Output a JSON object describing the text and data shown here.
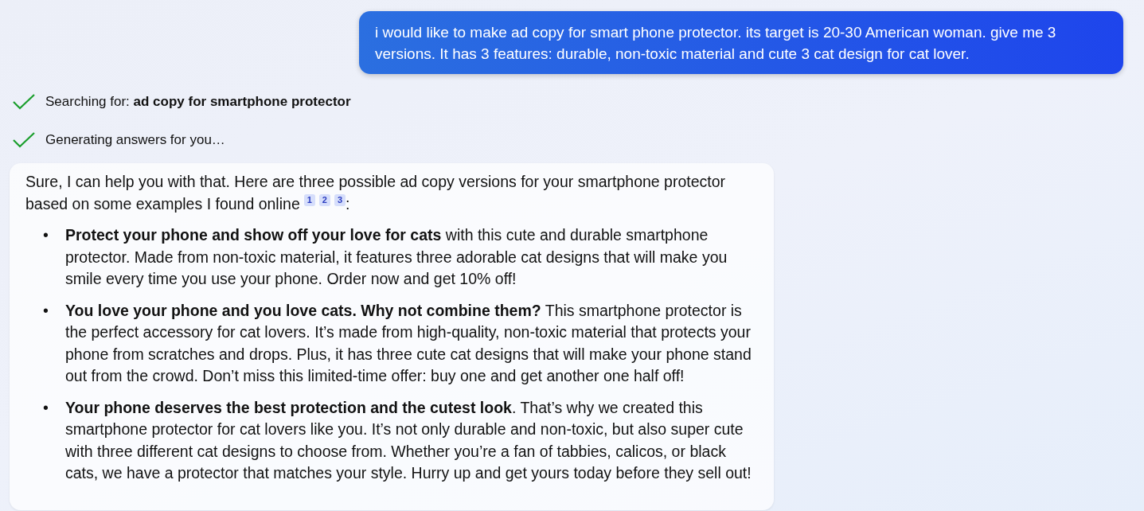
{
  "user_message": {
    "text": "i would like to make ad copy for smart phone protector. its target is 20-30 American woman. give me 3 versions. It has 3 features: durable, non-toxic material and cute 3 cat design for cat lover."
  },
  "progress": [
    {
      "text": "Searching for: **ad copy for smartphone protector**",
      "done": true
    },
    {
      "text": "Generating answers for you…",
      "done": true
    }
  ],
  "answer": {
    "intro": "Sure, I can help you with that. Here are three possible ad copy versions for your smartphone protector based on some examples I found online",
    "citations": [
      "1",
      "2",
      "3"
    ],
    "intro_tail": ":",
    "bullets": [
      {
        "marker": "•",
        "text": "**Protect your phone and show off your love for cats** with this cute and durable smartphone protector. Made from non-toxic material, it features three adorable cat designs that will make you smile every time you use your phone. Order now and get 10% off!"
      },
      {
        "marker": "•",
        "text": "**You love your phone and you love cats. Why not combine them?** This smartphone protector is the perfect accessory for cat lovers. It’s made from high-quality, non-toxic material that protects your phone from scratches and drops. Plus, it has three cute cat designs that will make your phone stand out from the crowd. Don’t miss this limited-time offer: buy one and get another one half off!"
      },
      {
        "marker": "•",
        "text": "**Your phone deserves the best protection and the cutest look**. That’s why we created this smartphone protector for cat lovers like you. It’s not only durable and non-toxic, but also super cute with three different cat designs to choose from. Whether you’re a fan of tabbies, calicos, or black cats, we have a protector that matches your style. Hurry up and get yours today before they sell out!"
      }
    ]
  }
}
